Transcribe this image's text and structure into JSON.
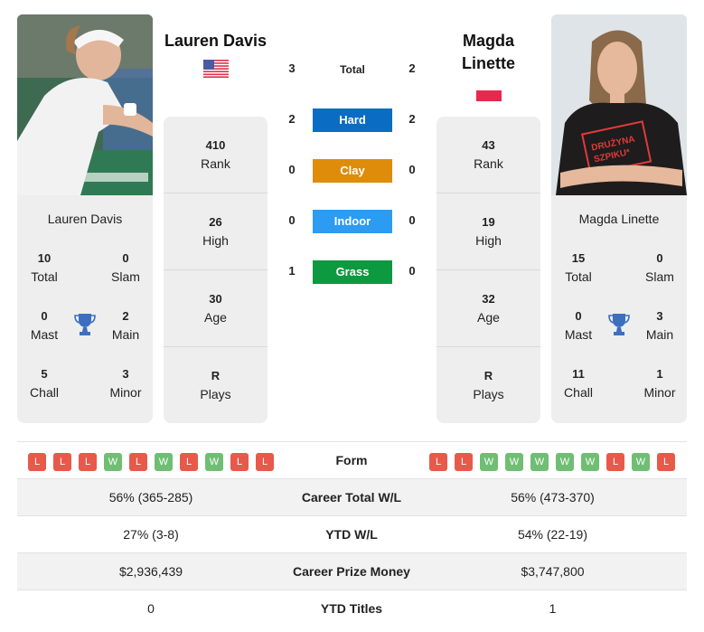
{
  "colors": {
    "hard": "#0a6cc2",
    "clay": "#de8c0a",
    "indoor": "#2b9cf2",
    "grass": "#0d9940",
    "win": "#6fbe73",
    "loss": "#e8594a",
    "trophy": "#3d6fc0"
  },
  "player1": {
    "name": "Lauren Davis",
    "flag": "usa-flag-icon",
    "titles": {
      "name": "Lauren Davis",
      "total": {
        "value": "10",
        "label": "Total"
      },
      "slam": {
        "value": "0",
        "label": "Slam"
      },
      "mast": {
        "value": "0",
        "label": "Mast"
      },
      "main": {
        "value": "2",
        "label": "Main"
      },
      "chall": {
        "value": "5",
        "label": "Chall"
      },
      "minor": {
        "value": "3",
        "label": "Minor"
      }
    },
    "stats": [
      {
        "value": "410",
        "label": "Rank"
      },
      {
        "value": "26",
        "label": "High"
      },
      {
        "value": "30",
        "label": "Age"
      },
      {
        "value": "R",
        "label": "Plays"
      }
    ],
    "form": [
      "L",
      "L",
      "L",
      "W",
      "L",
      "W",
      "L",
      "W",
      "L",
      "L"
    ]
  },
  "player2": {
    "name": "Magda Linette",
    "flag": "poland-flag-icon",
    "titles": {
      "name": "Magda Linette",
      "total": {
        "value": "15",
        "label": "Total"
      },
      "slam": {
        "value": "0",
        "label": "Slam"
      },
      "mast": {
        "value": "0",
        "label": "Mast"
      },
      "main": {
        "value": "3",
        "label": "Main"
      },
      "chall": {
        "value": "11",
        "label": "Chall"
      },
      "minor": {
        "value": "1",
        "label": "Minor"
      }
    },
    "stats": [
      {
        "value": "43",
        "label": "Rank"
      },
      {
        "value": "19",
        "label": "High"
      },
      {
        "value": "32",
        "label": "Age"
      },
      {
        "value": "R",
        "label": "Plays"
      }
    ],
    "form": [
      "L",
      "L",
      "W",
      "W",
      "W",
      "W",
      "W",
      "L",
      "W",
      "L"
    ]
  },
  "h2h": {
    "total": {
      "label": "Total",
      "p1": "3",
      "p2": "2"
    },
    "hard": {
      "label": "Hard",
      "p1": "2",
      "p2": "2"
    },
    "clay": {
      "label": "Clay",
      "p1": "0",
      "p2": "0"
    },
    "indoor": {
      "label": "Indoor",
      "p1": "0",
      "p2": "0"
    },
    "grass": {
      "label": "Grass",
      "p1": "1",
      "p2": "0"
    }
  },
  "comparison": {
    "form_label": "Form",
    "rows": [
      {
        "label": "Career Total W/L",
        "p1": "56% (365-285)",
        "p2": "56% (473-370)"
      },
      {
        "label": "YTD W/L",
        "p1": "27% (3-8)",
        "p2": "54% (22-19)"
      },
      {
        "label": "Career Prize Money",
        "p1": "$2,936,439",
        "p2": "$3,747,800"
      },
      {
        "label": "YTD Titles",
        "p1": "0",
        "p2": "1"
      }
    ]
  }
}
